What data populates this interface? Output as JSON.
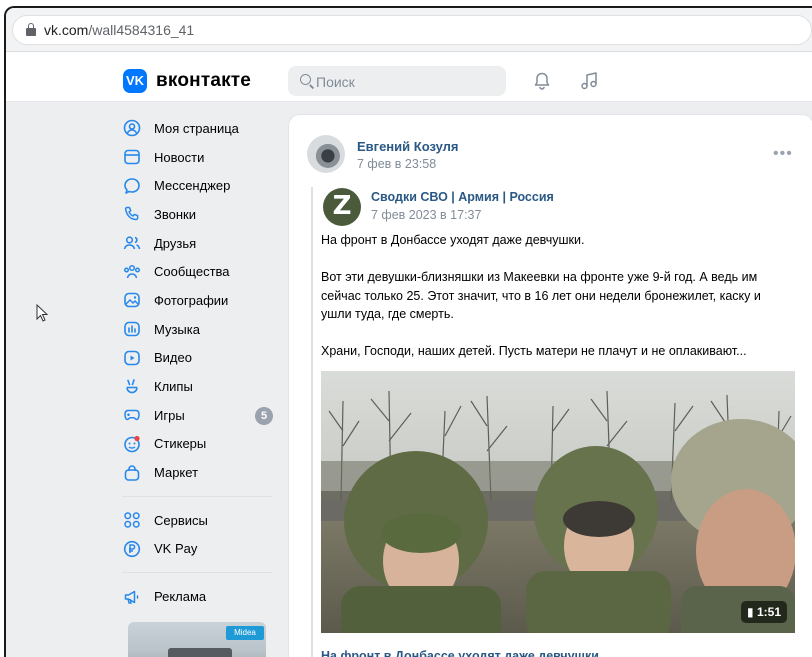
{
  "browser": {
    "url_domain": "vk.com",
    "url_path": "/wall4584316_41"
  },
  "header": {
    "logo_mark": "VK",
    "logo_text": "вконтакте",
    "search_placeholder": "Поиск"
  },
  "sidebar": {
    "items": [
      {
        "label": "Моя страница",
        "icon": "profile-icon"
      },
      {
        "label": "Новости",
        "icon": "news-icon"
      },
      {
        "label": "Мессенджер",
        "icon": "messenger-icon"
      },
      {
        "label": "Звонки",
        "icon": "phone-icon"
      },
      {
        "label": "Друзья",
        "icon": "friends-icon"
      },
      {
        "label": "Сообщества",
        "icon": "communities-icon"
      },
      {
        "label": "Фотографии",
        "icon": "photos-icon"
      },
      {
        "label": "Музыка",
        "icon": "music-icon"
      },
      {
        "label": "Видео",
        "icon": "video-icon"
      },
      {
        "label": "Клипы",
        "icon": "clips-icon"
      },
      {
        "label": "Игры",
        "icon": "games-icon",
        "badge": "5"
      },
      {
        "label": "Стикеры",
        "icon": "stickers-icon"
      },
      {
        "label": "Маркет",
        "icon": "market-icon"
      }
    ],
    "secondary": [
      {
        "label": "Сервисы",
        "icon": "services-icon"
      },
      {
        "label": "VK Pay",
        "icon": "vkpay-icon"
      }
    ],
    "ads_label": "Реклама",
    "ad_brand": "Midea"
  },
  "post": {
    "author": "Евгений Козуля",
    "time": "7 фев в 23:58",
    "menu": "•••",
    "repost": {
      "source_name": "Сводки СВО | Армия | Россия",
      "source_time": "7 фев 2023 в 17:37",
      "paragraphs": [
        "На фронт в Донбассе уходят даже девчушки.",
        "Вот эти девушки-близняшки из Макеевки на фронте уже 9-й год. А ведь им сейчас только 25. Этот значит, что в 16 лет они недели бронежилет, каску и ушли туда, где смерть.",
        "Храни, Господи, наших детей. Пусть матери не плачут и не оплакивают..."
      ],
      "video_duration": "1:51",
      "video_title": "На фронт в Донбассе уходят даже девчушки."
    }
  },
  "colors": {
    "vk_blue": "#0077ff",
    "link": "#2a5885",
    "muted": "#818c99",
    "page_bg": "#edeef0"
  }
}
